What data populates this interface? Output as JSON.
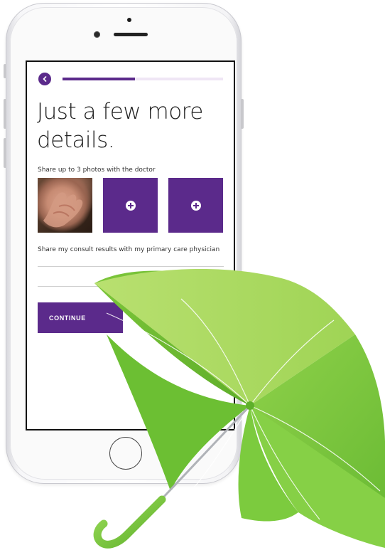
{
  "screen": {
    "progress_fraction": 0.45,
    "title_line1": "Just a few more",
    "title_line2": "details.",
    "photos_label": "Share up to 3 photos with the doctor",
    "photos": [
      "hand-photo",
      "add-photo",
      "add-photo"
    ],
    "physician_label": "Share my consult results with my primary care physician",
    "physician_select_value": "",
    "continue_label": "CONTINUE"
  },
  "icons": {
    "back": "chevron-left-icon",
    "add": "plus-circle-icon",
    "dropdown": "chevron-down-icon"
  },
  "colors": {
    "accent": "#5b2a8b",
    "progress_track": "#efe6f5",
    "umbrella_green": "#8bd34a"
  }
}
